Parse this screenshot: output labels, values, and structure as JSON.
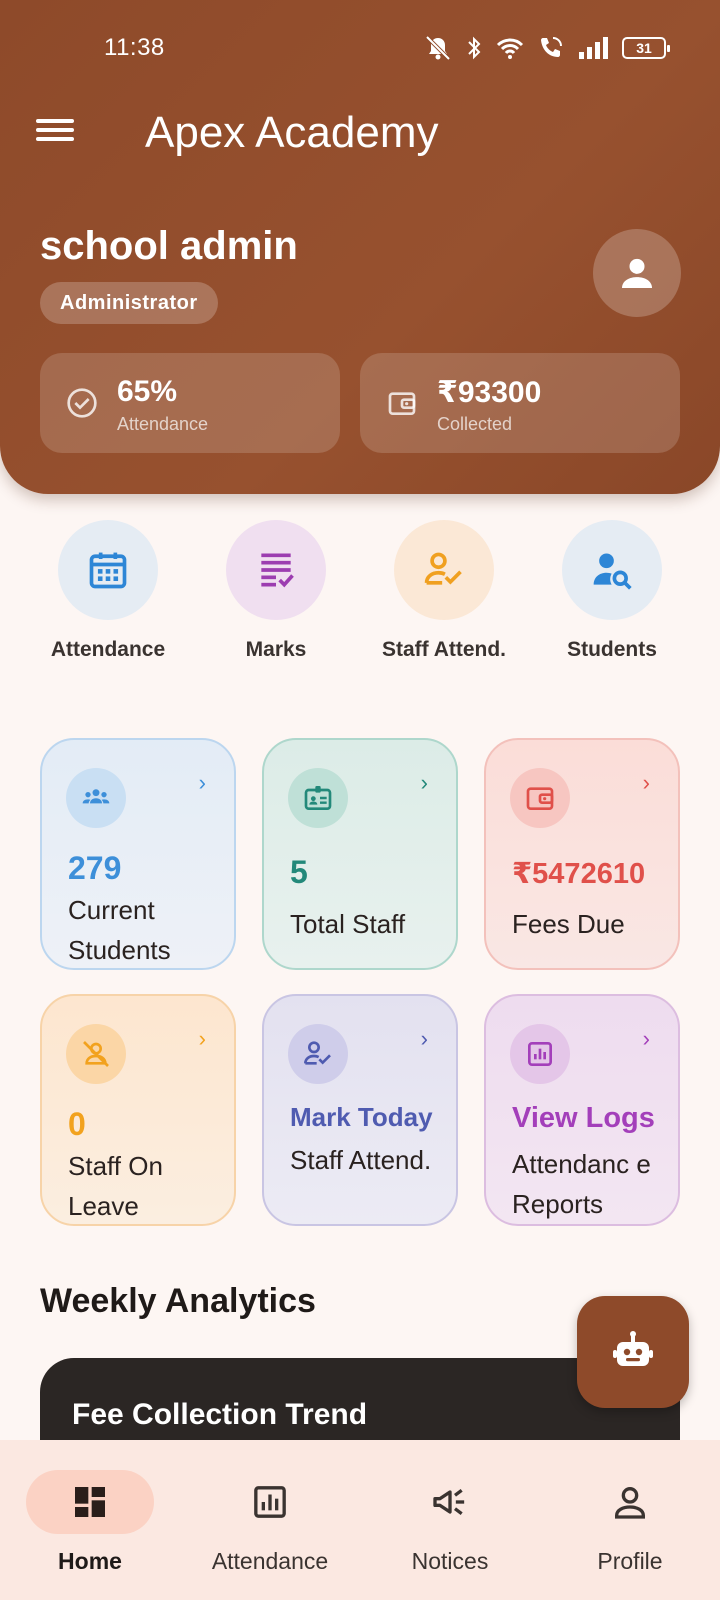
{
  "status": {
    "time": "11:38",
    "battery": "31"
  },
  "app": {
    "title": "Apex Academy"
  },
  "user": {
    "name": "school admin",
    "role": "Administrator"
  },
  "summary": [
    {
      "value": "65%",
      "label": "Attendance",
      "icon": "check-circle-icon"
    },
    {
      "value": "₹93300",
      "label": "Collected",
      "icon": "wallet-icon"
    }
  ],
  "quick_actions": [
    {
      "label": "Attendance",
      "icon": "calendar-icon",
      "bg": "#e5ecf3",
      "color": "#2d86d6"
    },
    {
      "label": "Marks",
      "icon": "checklist-icon",
      "bg": "#f0dff0",
      "color": "#9c3db0"
    },
    {
      "label": "Staff Attend.",
      "icon": "person-check-icon",
      "bg": "#fbe8d6",
      "color": "#f0a020"
    },
    {
      "label": "Students",
      "icon": "person-search-icon",
      "bg": "#e5ecf3",
      "color": "#2d86d6"
    }
  ],
  "stats": [
    {
      "value": "279",
      "label": "Current Students",
      "icon": "group-icon",
      "color": "#3d8fd9"
    },
    {
      "value": "5",
      "label": "Total Staff",
      "icon": "id-badge-icon",
      "color": "#23897a"
    },
    {
      "value": "₹5472610",
      "label": "Fees Due",
      "icon": "wallet-icon",
      "color": "#e0504a"
    },
    {
      "value": "0",
      "label": "Staff On Leave",
      "icon": "person-off-icon",
      "color": "#f2a21e"
    },
    {
      "value": "Mark Today",
      "label": "Staff Attend.",
      "icon": "person-check-icon",
      "color": "#4f5bb0"
    },
    {
      "value": "View Logs",
      "label": "Attendanc e Reports",
      "icon": "chart-icon",
      "color": "#a33fba"
    }
  ],
  "section": {
    "title": "Weekly Analytics"
  },
  "trend": {
    "title": "Fee Collection Trend"
  },
  "nav": [
    {
      "label": "Home",
      "icon": "dashboard-icon"
    },
    {
      "label": "Attendance",
      "icon": "bar-chart-icon"
    },
    {
      "label": "Notices",
      "icon": "megaphone-icon"
    },
    {
      "label": "Profile",
      "icon": "person-icon"
    }
  ]
}
